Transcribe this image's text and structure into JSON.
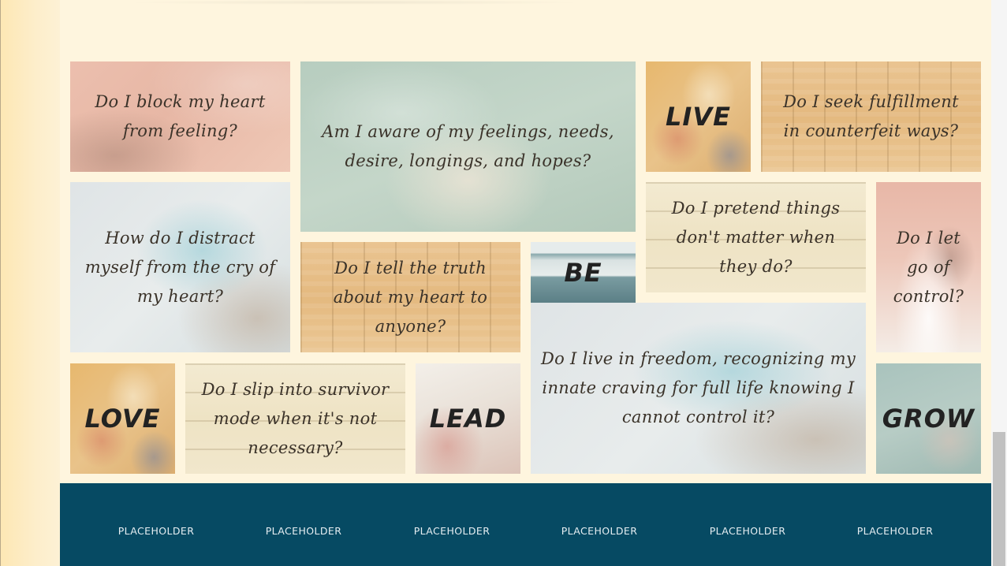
{
  "tiles": {
    "q1": "Do I block my heart from feeling?",
    "q2": "Am I aware of my feelings, needs, desire, longings, and hopes?",
    "w_live": "LIVE",
    "q3": "Do I seek fulfillment in counterfeit ways?",
    "q4": "How do I distract myself from the cry of my heart?",
    "q5": "Do I pretend things don't matter when they do?",
    "q6": "Do I let go of control?",
    "q7": "Do I tell the truth about my heart to anyone?",
    "w_be": "BE",
    "q8": "Do I live in freedom, recognizing my innate craving for full life knowing I cannot control it?",
    "w_love": "LOVE",
    "q9": "Do I slip into survivor mode when it's not necessary?",
    "w_lead": "LEAD",
    "w_grow": "GROW"
  },
  "footer": {
    "links": [
      "PLACEHOLDER",
      "PLACEHOLDER",
      "PLACEHOLDER",
      "PLACEHOLDER",
      "PLACEHOLDER",
      "PLACEHOLDER"
    ]
  }
}
